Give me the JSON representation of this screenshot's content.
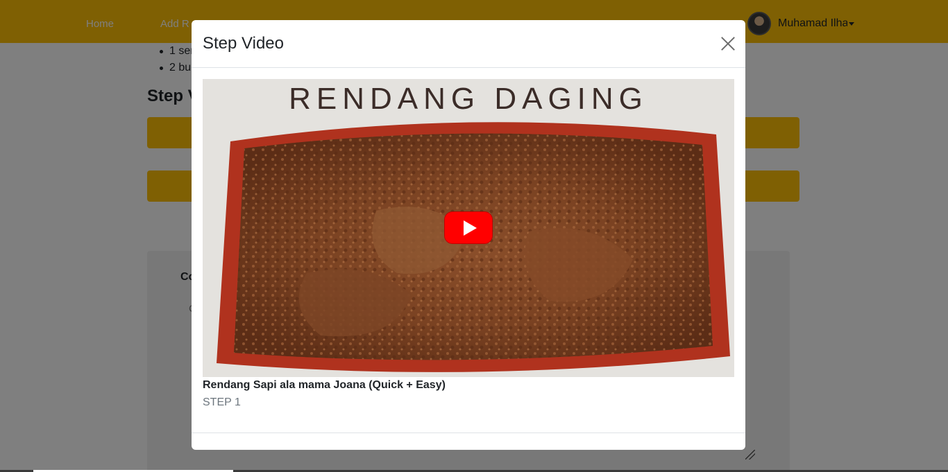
{
  "navbar": {
    "links": {
      "home": "Home",
      "add_recipe": "Add R"
    },
    "user": {
      "name": "Muhamad Ilha"
    },
    "icons": {
      "avatar": "user-avatar",
      "caret": "caret-down-icon"
    }
  },
  "page": {
    "ingredients": [
      "1 sen",
      "2 bu"
    ],
    "section_title": "Step V",
    "comment": {
      "title": "Co",
      "field_hint": "C"
    }
  },
  "modal": {
    "title": "Step Video",
    "close_icon": "close-icon",
    "video": {
      "thumbnail_text": "RENDANG DAGING",
      "play_icon": "youtube-play-icon",
      "title": "Rendang Sapi ala mama Joana (Quick + Easy)",
      "step": "STEP 1"
    }
  },
  "colors": {
    "brand_yellow": "#ffc107",
    "youtube_red": "#ff0000",
    "backdrop": "rgba(0,0,0,0.5)"
  }
}
